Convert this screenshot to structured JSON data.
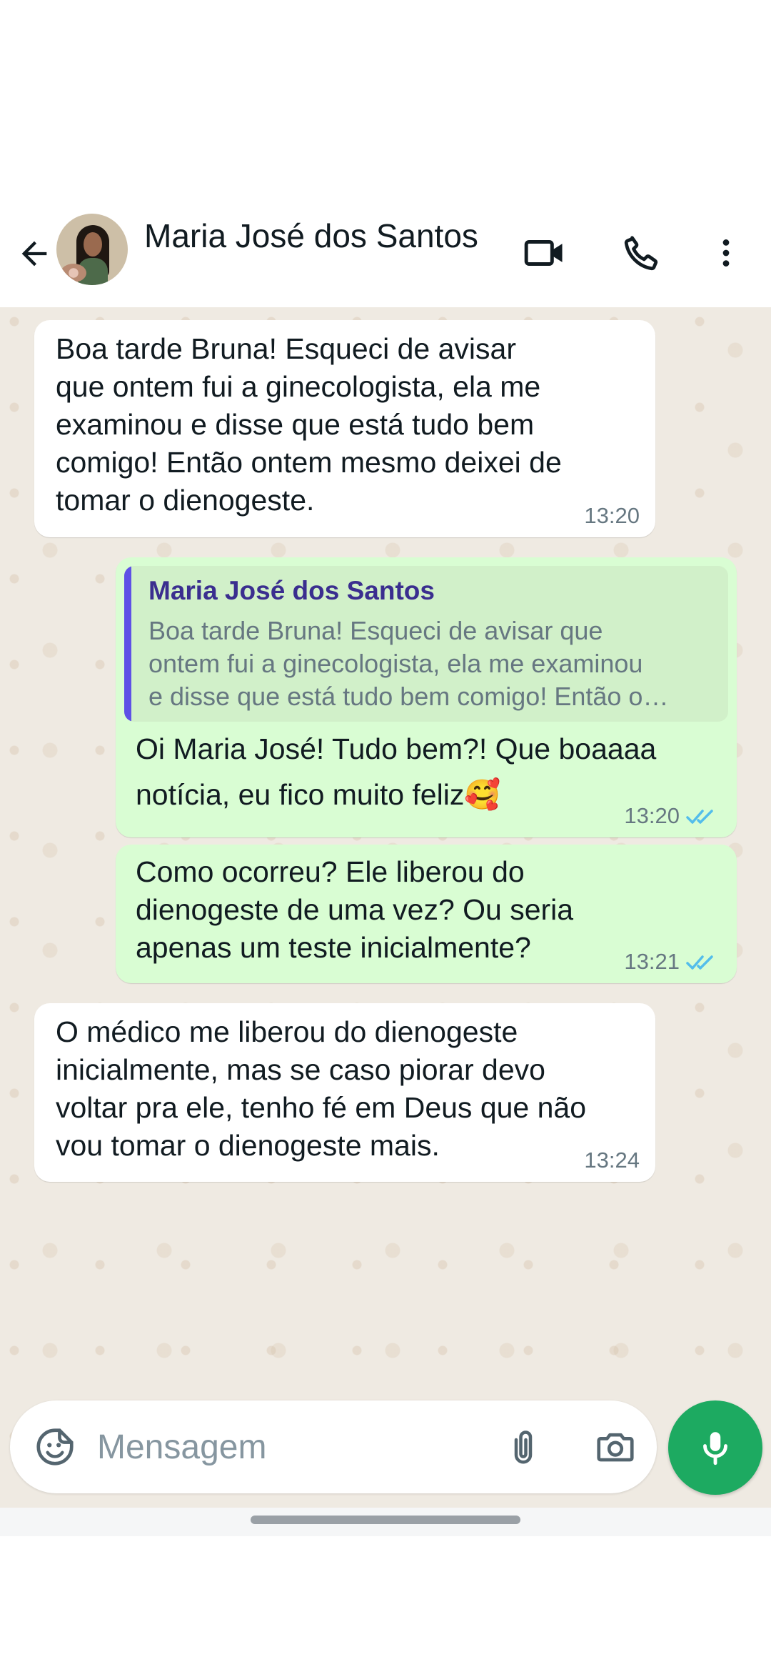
{
  "header": {
    "contact_name": "Maria José dos Santos",
    "back_icon": "arrow-left-icon",
    "video_icon": "video-call-icon",
    "call_icon": "phone-icon",
    "more_icon": "more-vertical-icon"
  },
  "messages": [
    {
      "direction": "incoming",
      "text": "Boa tarde Bruna! Esqueci de avisar\nque ontem fui a ginecologista, ela me\nexaminou e disse que está tudo bem\ncomigo! Então ontem mesmo deixei de\ntomar o dienogeste.",
      "time": "13:20"
    },
    {
      "direction": "outgoing",
      "quote_author": "Maria José dos Santos",
      "quote_text": "Boa tarde Bruna! Esqueci de avisar que\nontem fui a ginecologista, ela me examinou\ne disse que está tudo bem comigo! Então o…",
      "text": "Oi Maria José! Tudo bem?! Que boaaaa\nnotícia, eu fico muito feliz🥰",
      "time": "13:20",
      "status": "read"
    },
    {
      "direction": "outgoing",
      "text": "Como ocorreu? Ele liberou do\ndienogeste de uma vez? Ou seria\napenas um teste inicialmente?",
      "time": "13:21",
      "status": "read"
    },
    {
      "direction": "incoming",
      "text": "O médico me liberou do dienogeste\ninicialmente, mas se caso piorar devo\nvoltar pra ele, tenho fé em Deus que não\nvou tomar o dienogeste mais.",
      "time": "13:24"
    }
  ],
  "composer": {
    "placeholder": "Mensagem",
    "sticker_icon": "sticker-icon",
    "attach_icon": "paperclip-icon",
    "camera_icon": "camera-icon",
    "mic_icon": "microphone-icon"
  },
  "colors": {
    "incoming_bubble": "#ffffff",
    "outgoing_bubble": "#d9fdd3",
    "chat_background": "#efeae2",
    "read_ticks": "#53bdeb",
    "mic_button": "#1daa61",
    "quote_bar": "#5e50e6"
  }
}
